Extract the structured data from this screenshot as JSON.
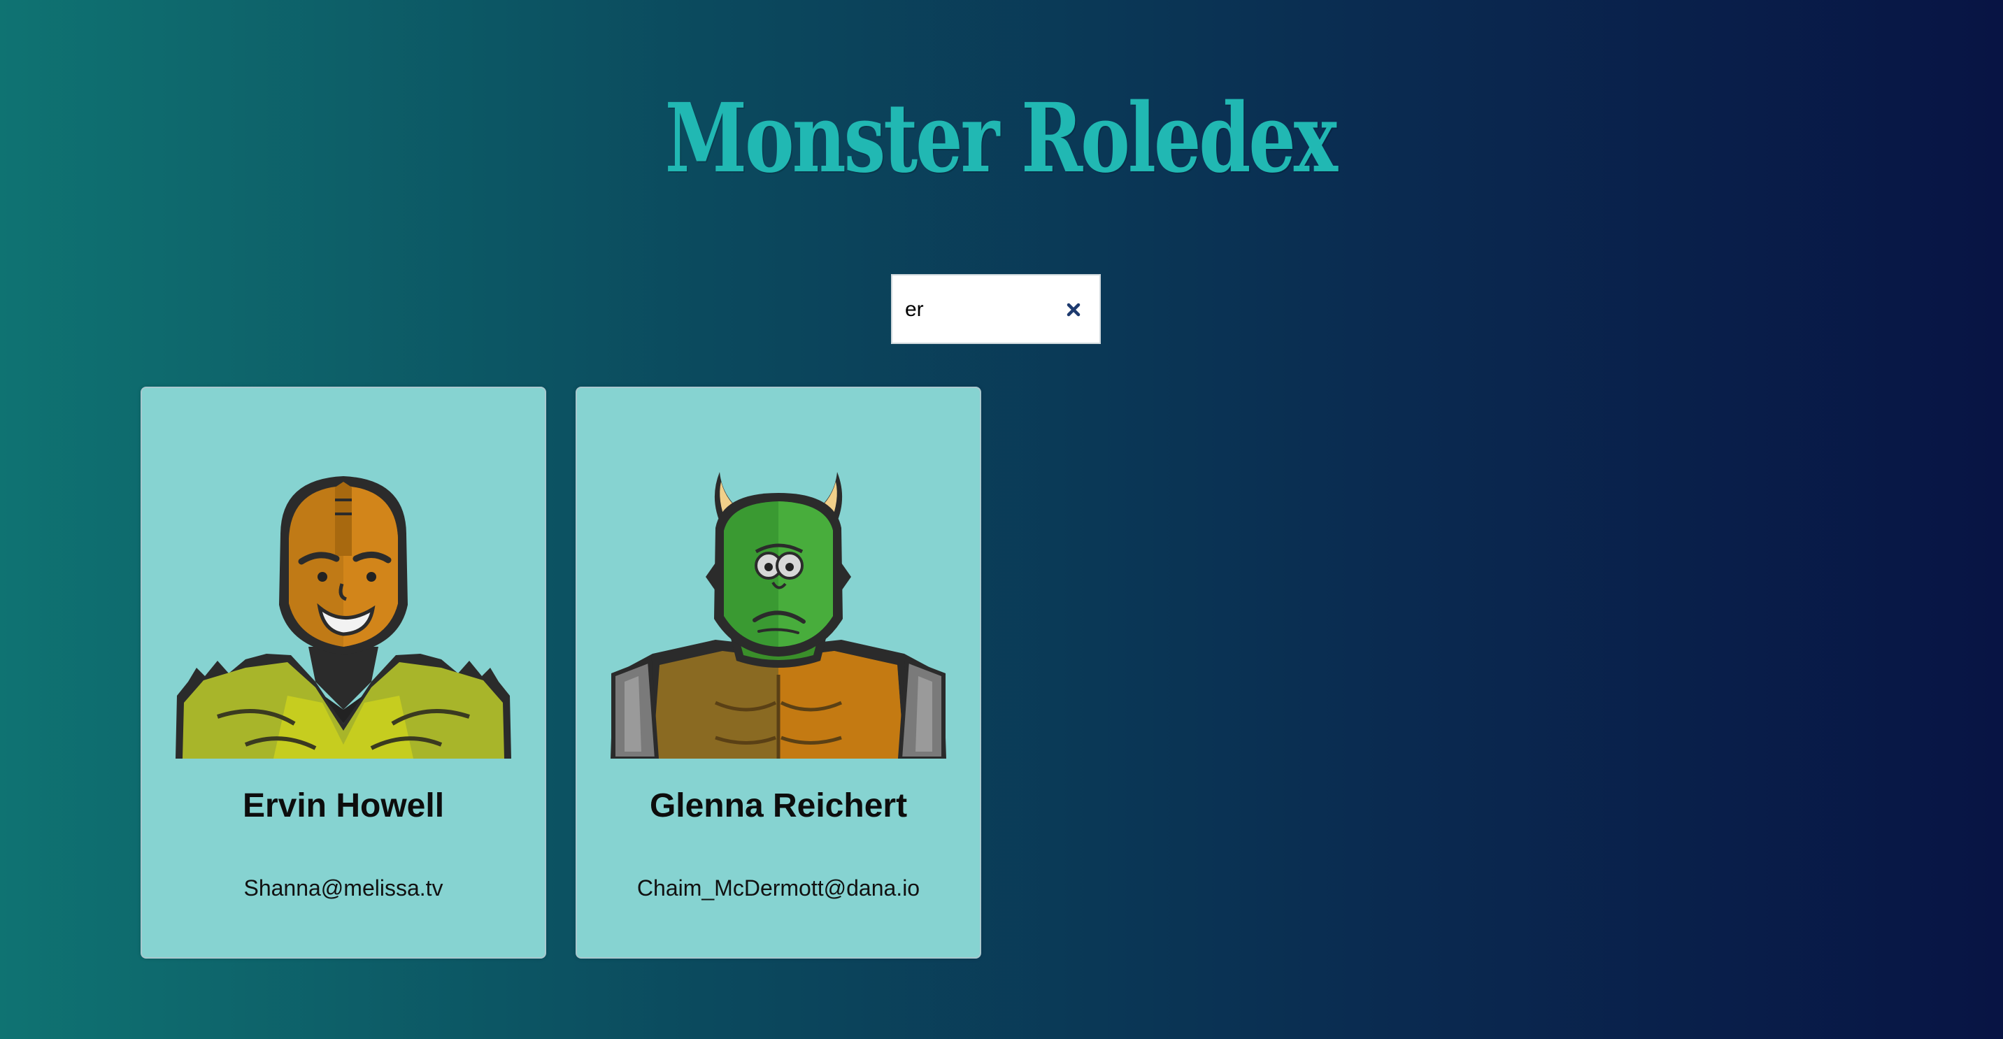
{
  "app": {
    "title": "Monster Roledex"
  },
  "search": {
    "value": "er",
    "clear_icon": "close-icon"
  },
  "monsters": [
    {
      "name": "Ervin Howell",
      "email": "Shanna@melissa.tv",
      "avatar_icon": "robot-avatar-spiky-icon"
    },
    {
      "name": "Glenna Reichert",
      "email": "Chaim_McDermott@dana.io",
      "avatar_icon": "horned-monster-avatar-icon"
    }
  ],
  "colors": {
    "title": "#21b8b3",
    "card_background": "#86d3d1",
    "background_start": "#0f7372",
    "background_end": "#081444"
  }
}
